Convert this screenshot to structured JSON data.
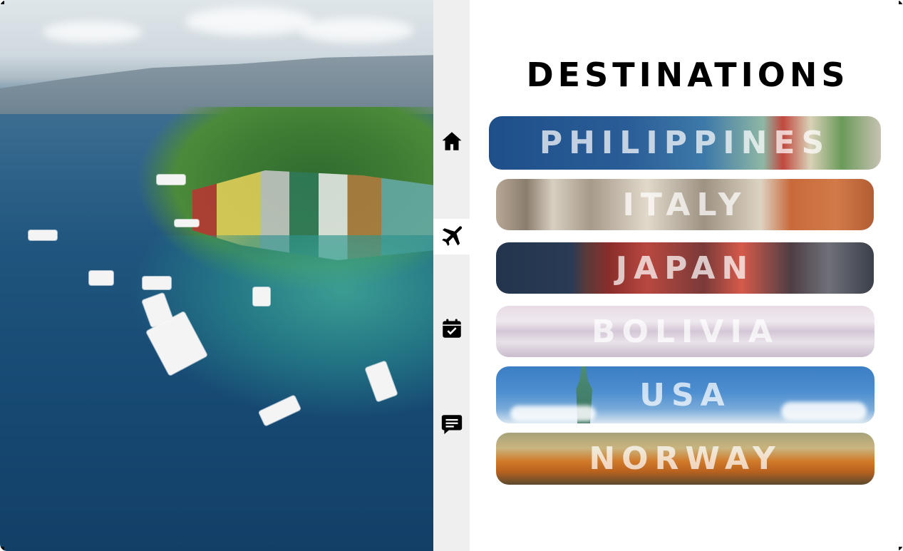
{
  "page": {
    "title": "DESTINATIONS"
  },
  "hero": {
    "image": "island-harbor-with-outrigger-boats-photo"
  },
  "sidenav": {
    "items": [
      {
        "id": "home",
        "icon": "home-icon"
      },
      {
        "id": "flights",
        "icon": "airplane-icon",
        "active": true
      },
      {
        "id": "bookings",
        "icon": "calendar-check-icon"
      },
      {
        "id": "messages",
        "icon": "chat-icon"
      }
    ]
  },
  "destinations": [
    {
      "label": "PHILIPPINES",
      "image": "philippines-coast-photo"
    },
    {
      "label": "ITALY",
      "image": "italy-fountain-statues-photo"
    },
    {
      "label": "JAPAN",
      "image": "japan-lanterns-photo"
    },
    {
      "label": "BOLIVIA",
      "image": "bolivia-salt-flat-photo"
    },
    {
      "label": "USA",
      "image": "usa-statue-of-liberty-photo"
    },
    {
      "label": "NORWAY",
      "image": "norway-houses-photo"
    }
  ]
}
